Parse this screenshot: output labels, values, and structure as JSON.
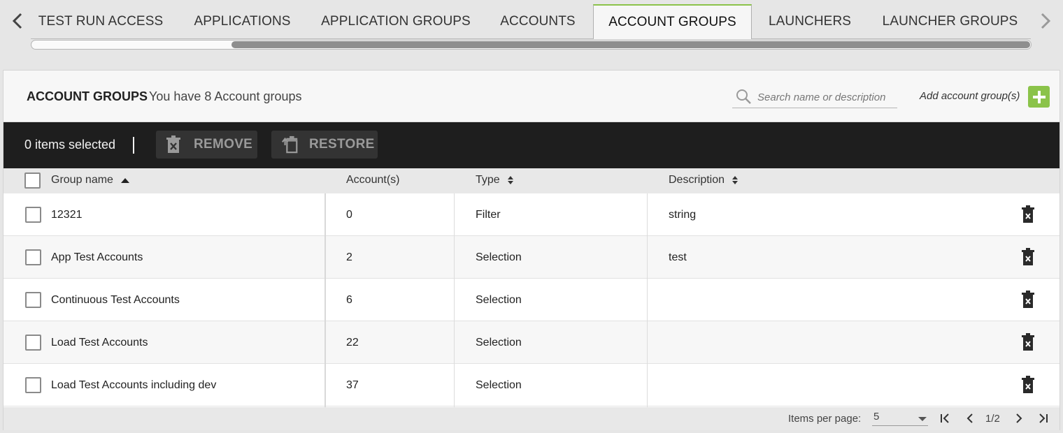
{
  "tabs": [
    {
      "label": "TEST RUN ACCESS"
    },
    {
      "label": "APPLICATIONS"
    },
    {
      "label": "APPLICATION GROUPS"
    },
    {
      "label": "ACCOUNTS"
    },
    {
      "label": "ACCOUNT GROUPS",
      "active": true
    },
    {
      "label": "LAUNCHERS"
    },
    {
      "label": "LAUNCHER GROUPS"
    }
  ],
  "header": {
    "title": "ACCOUNT GROUPS",
    "subtitle": "You have 8 Account groups",
    "search_placeholder": "Search name or description",
    "add_label": "Add account group(s)"
  },
  "actionbar": {
    "selected": "0 items selected",
    "remove_label": "REMOVE",
    "restore_label": "RESTORE"
  },
  "table": {
    "columns": [
      "Group name",
      "Account(s)",
      "Type",
      "Description"
    ],
    "rows": [
      {
        "name": "12321",
        "accounts": "0",
        "type": "Filter",
        "description": "string"
      },
      {
        "name": "App Test Accounts",
        "accounts": "2",
        "type": "Selection",
        "description": "test"
      },
      {
        "name": "Continuous Test Accounts",
        "accounts": "6",
        "type": "Selection",
        "description": ""
      },
      {
        "name": "Load Test Accounts",
        "accounts": "22",
        "type": "Selection",
        "description": ""
      },
      {
        "name": "Load Test Accounts including dev",
        "accounts": "37",
        "type": "Selection",
        "description": ""
      }
    ]
  },
  "footer": {
    "items_per_page_label": "Items per page:",
    "items_per_page_value": "5",
    "page_text": "1/2"
  },
  "colors": {
    "accent_green": "#8bc34a",
    "action_bar": "#1e1e1e"
  }
}
